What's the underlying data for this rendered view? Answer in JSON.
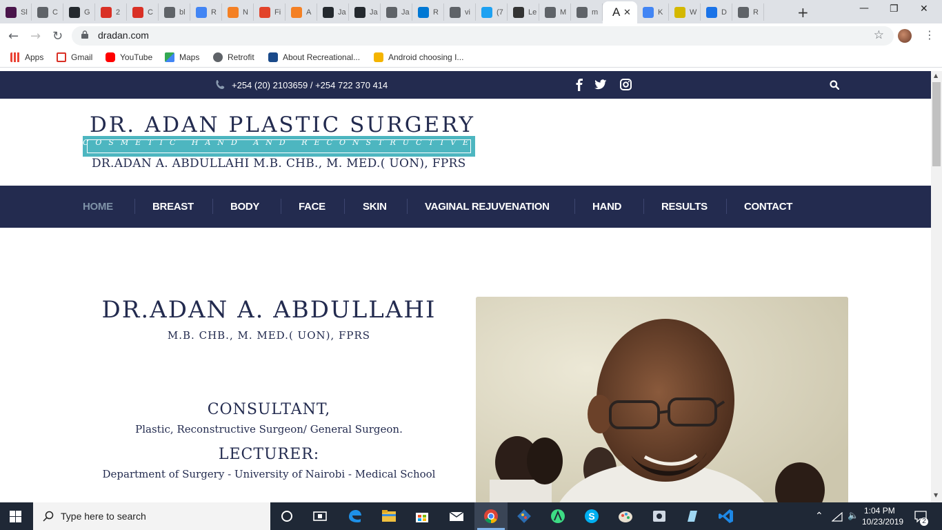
{
  "browser": {
    "tabs": [
      {
        "label": "Sl",
        "color": "#4a154b"
      },
      {
        "label": "C",
        "color": "#5f6368"
      },
      {
        "label": "G",
        "color": "#24292e"
      },
      {
        "label": "2",
        "color": "#d93025"
      },
      {
        "label": "C",
        "color": "#d93025"
      },
      {
        "label": "bl",
        "color": "#5f6368"
      },
      {
        "label": "R",
        "color": "#4285f4"
      },
      {
        "label": "N",
        "color": "#f48024"
      },
      {
        "label": "Fi",
        "color": "#e2432a"
      },
      {
        "label": "A",
        "color": "#f48024"
      },
      {
        "label": "Ja",
        "color": "#24292e"
      },
      {
        "label": "Ja",
        "color": "#24292e"
      },
      {
        "label": "Ja",
        "color": "#5f6368"
      },
      {
        "label": "R",
        "color": "#0078d4"
      },
      {
        "label": "vi",
        "color": "#5f6368"
      },
      {
        "label": "(7",
        "color": "#1da1f2"
      },
      {
        "label": "Le",
        "color": "#333333"
      },
      {
        "label": "M",
        "color": "#5f6368"
      },
      {
        "label": "m",
        "color": "#5f6368"
      },
      {
        "label": "A",
        "color": "#ffffff"
      },
      {
        "label": "K",
        "color": "#4285f4"
      },
      {
        "label": "W",
        "color": "#d4b800"
      },
      {
        "label": "D",
        "color": "#1a73e8"
      },
      {
        "label": "R",
        "color": "#5f6368"
      }
    ],
    "active_tab_glyph": "A",
    "new_tab": "+",
    "url": "dradan.com",
    "bookmarks": [
      {
        "label": "Apps",
        "color": "#ea4335"
      },
      {
        "label": "Gmail",
        "color": "#d93025"
      },
      {
        "label": "YouTube",
        "color": "#ff0000"
      },
      {
        "label": "Maps",
        "color": "#34a853"
      },
      {
        "label": "Retrofit",
        "color": "#5f6368"
      },
      {
        "label": "About Recreational...",
        "color": "#1a4a8a"
      },
      {
        "label": "Android choosing I...",
        "color": "#f4b400"
      }
    ]
  },
  "site": {
    "phone": "+254 (20) 2103659 / +254 722 370 414",
    "logo": {
      "line1": "DR. ADAN PLASTIC SURGERY",
      "tagline": "COSMETIC HAND AND RECONSTRUCTIVE",
      "line3": "DR.ADAN A. ABDULLAHI M.B. CHB., M. MED.( UON),   FPRS"
    },
    "nav": [
      "HOME",
      "BREAST",
      "BODY",
      "FACE",
      "SKIN",
      "VAGINAL REJUVENATION",
      "HAND",
      "RESULTS",
      "CONTACT"
    ],
    "bio": {
      "name": "DR.ADAN A. ABDULLAHI",
      "quals": "M.B. CHB., M. MED.( UON), FPRS",
      "role1_title": "CONSULTANT,",
      "role1_text": "Plastic, Reconstructive Surgeon/ General Surgeon.",
      "role2_title": "LECTURER:",
      "role2_text": "Department of Surgery - University of Nairobi - Medical School"
    },
    "colors": {
      "navy": "#232b4f",
      "teal": "#4db6c0",
      "nav_active": "#7f93a8"
    }
  },
  "taskbar": {
    "search_placeholder": "Type here to search",
    "time": "1:04 PM",
    "date": "10/23/2019",
    "notifications": "2"
  }
}
